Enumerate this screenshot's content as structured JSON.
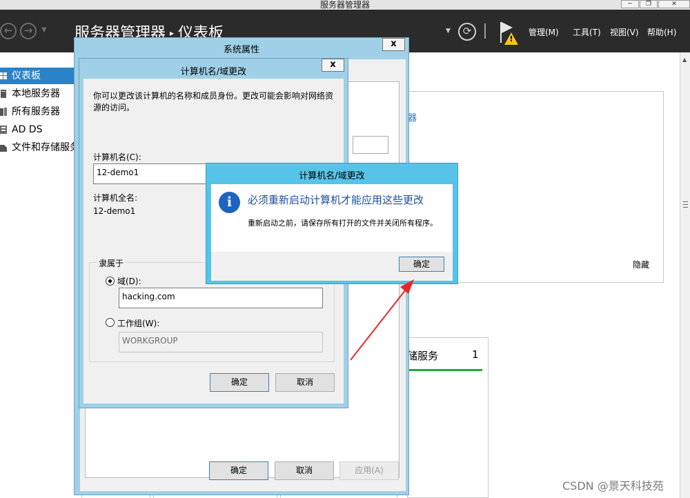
{
  "window": {
    "title": "服务器管理器",
    "minimize": "─",
    "restore": "❐",
    "close": "✕"
  },
  "header": {
    "breadcrumb_root": "服务器管理器",
    "breadcrumb_sep": "▸",
    "breadcrumb_page": "仪表板",
    "menus": [
      "管理(M)",
      "工具(T)",
      "视图(V)",
      "帮助(H)"
    ]
  },
  "sidebar": {
    "items": [
      {
        "label": "仪表板",
        "active": true
      },
      {
        "label": "本地服务器",
        "active": false
      },
      {
        "label": "所有服务器",
        "active": false
      },
      {
        "label": "AD DS",
        "active": false
      },
      {
        "label": "文件和存储服务",
        "active": false
      }
    ]
  },
  "dashboard": {
    "link_fragment": "器",
    "hide_label": "隐藏",
    "tile_title": "储服务",
    "tile_count": "1"
  },
  "system_properties": {
    "title": "系统属性",
    "close": "x",
    "ok": "确定",
    "cancel": "取消",
    "apply": "应用(A)"
  },
  "computer_name_dialog": {
    "title": "计算机名/域更改",
    "close": "x",
    "description": "你可以更改该计算机的名称和成员身份。更改可能会影响对网络资源的访问。",
    "name_label": "计算机名(C):",
    "name_value": "12-demo1",
    "full_name_label": "计算机全名:",
    "full_name_value": "12-demo1",
    "member_of": "隶属于",
    "domain_label": "域(D):",
    "domain_value": "hacking.com",
    "workgroup_label": "工作组(W):",
    "workgroup_value": "WORKGROUP",
    "ok": "确定",
    "cancel": "取消"
  },
  "restart_message": {
    "title": "计算机名/域更改",
    "heading": "必须重新启动计算机才能应用这些更改",
    "body": "重新启动之前，请保存所有打开的文件并关闭所有程序。",
    "ok": "确定",
    "icon": "info-icon"
  },
  "watermark": "CSDN @景天科技苑",
  "colors": {
    "header_bg": "#2b2b2b",
    "accent": "#2a82c8",
    "dialog_frame": "#9fd0e8",
    "message_frame": "#57c3e8",
    "annotation_arrow": "#e8262a",
    "status_green": "#21a936"
  }
}
